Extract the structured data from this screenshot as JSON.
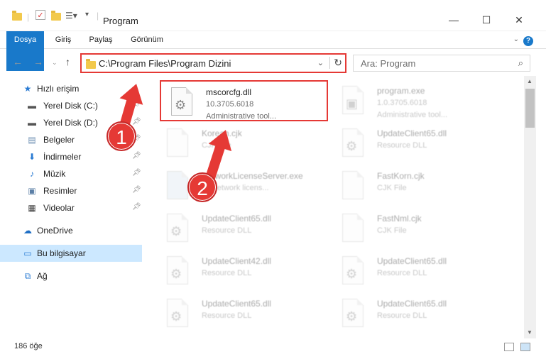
{
  "window": {
    "title": "Program",
    "minimize": "—",
    "maximize": "☐",
    "close": "✕"
  },
  "ribbon": {
    "tabs": [
      "Dosya",
      "Giriş",
      "Paylaş",
      "Görünüm"
    ],
    "help": "?"
  },
  "address": {
    "path": "C:\\Program Files\\Program Dizini",
    "search_placeholder": "Ara: Program"
  },
  "sidebar": {
    "quick_access": "Hızlı erişim",
    "items": [
      {
        "label": "Yerel Disk (C:)"
      },
      {
        "label": "Yerel Disk (D:)"
      },
      {
        "label": "Belgeler"
      },
      {
        "label": "İndirmeler"
      },
      {
        "label": "Müzik"
      },
      {
        "label": "Resimler"
      },
      {
        "label": "Videolar"
      }
    ],
    "onedrive": "OneDrive",
    "this_pc": "Bu bilgisayar",
    "network": "Ağ"
  },
  "files": [
    {
      "name": "mscorcfg.dll",
      "meta": "10.3705.6018",
      "meta2": "Administrative tool..."
    },
    {
      "name": "program.exe",
      "meta": "1.0.3705.6018",
      "meta2": "Administrative tool..."
    },
    {
      "name": "Korean.cjk",
      "meta": "CJK File",
      "meta2": ""
    },
    {
      "name": "UpdateClient65.dll",
      "meta": "Resource DLL",
      "meta2": ""
    },
    {
      "name": "NetworkLicenseServer.exe",
      "meta": "JY network licens...",
      "meta2": ""
    },
    {
      "name": "FastKorn.cjk",
      "meta": "CJK File",
      "meta2": ""
    },
    {
      "name": "UpdateClient65.dll",
      "meta": "Resource DLL",
      "meta2": ""
    },
    {
      "name": "FastNml.cjk",
      "meta": "CJK File",
      "meta2": ""
    },
    {
      "name": "UpdateClient42.dll",
      "meta": "Resource DLL",
      "meta2": ""
    },
    {
      "name": "UpdateClient65.dll",
      "meta": "Resource DLL",
      "meta2": ""
    },
    {
      "name": "UpdateClient65.dll",
      "meta": "Resource DLL",
      "meta2": ""
    },
    {
      "name": "UpdateClient65.dll",
      "meta": "Resource DLL",
      "meta2": ""
    }
  ],
  "status": {
    "count": "186 öğe"
  },
  "annotations": {
    "step1": "1",
    "step2": "2",
    "color": "#e53935"
  }
}
